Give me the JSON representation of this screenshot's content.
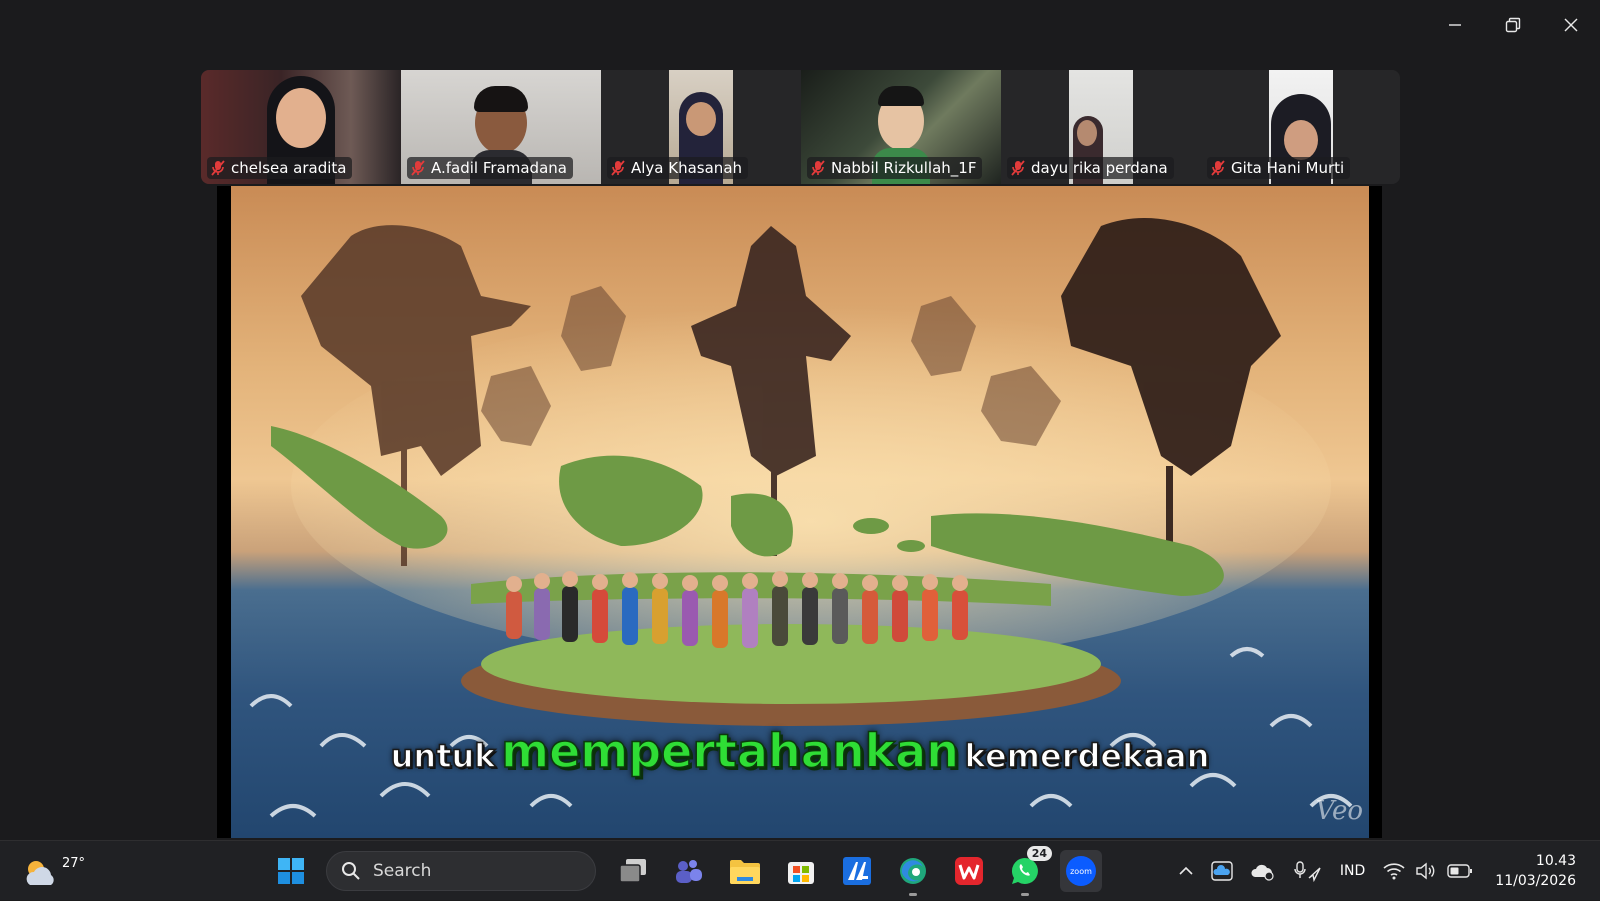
{
  "window": {
    "controls": [
      {
        "name": "minimize-button",
        "icon": "minimize-icon"
      },
      {
        "name": "restore-button",
        "icon": "restore-icon"
      },
      {
        "name": "close-button",
        "icon": "close-icon"
      }
    ]
  },
  "participants": [
    {
      "name": "chelsea aradita",
      "muted": true,
      "active": false
    },
    {
      "name": "A.fadil Framadana",
      "muted": true,
      "active": true
    },
    {
      "name": "Alya Khasanah",
      "muted": true,
      "active": false
    },
    {
      "name": "Nabbil Rizkullah_1F",
      "muted": true,
      "active": false
    },
    {
      "name": "dayu rika perdana",
      "muted": true,
      "active": false
    },
    {
      "name": "Gita Hani Murti",
      "muted": true,
      "active": false
    }
  ],
  "shared_screen": {
    "caption": {
      "word1": "untuk",
      "word2": "mempertahankan",
      "word3": "kemerdekaan"
    },
    "watermark": "Veo"
  },
  "taskbar": {
    "weather": {
      "temp": "27°",
      "icon": "partly-cloudy-icon"
    },
    "search": {
      "label": "Search"
    },
    "apps": [
      {
        "name": "task-view",
        "icon": "task-view-icon"
      },
      {
        "name": "teams",
        "icon": "teams-icon"
      },
      {
        "name": "file-explorer",
        "icon": "folder-icon"
      },
      {
        "name": "microsoft-store",
        "icon": "store-icon"
      },
      {
        "name": "editor",
        "icon": "editor-icon"
      },
      {
        "name": "edge",
        "icon": "edge-icon"
      },
      {
        "name": "wps",
        "icon": "wps-icon"
      },
      {
        "name": "whatsapp",
        "icon": "whatsapp-icon",
        "badge": "24"
      },
      {
        "name": "zoom",
        "icon": "zoom-icon",
        "label": "zoom"
      }
    ],
    "tray": {
      "language": "IND",
      "time": "10.43",
      "date": "11/03/2026"
    }
  },
  "colors": {
    "active_speaker": "#2fcf6a",
    "caption_highlight": "#2fdd35",
    "taskbar": "#202124"
  }
}
